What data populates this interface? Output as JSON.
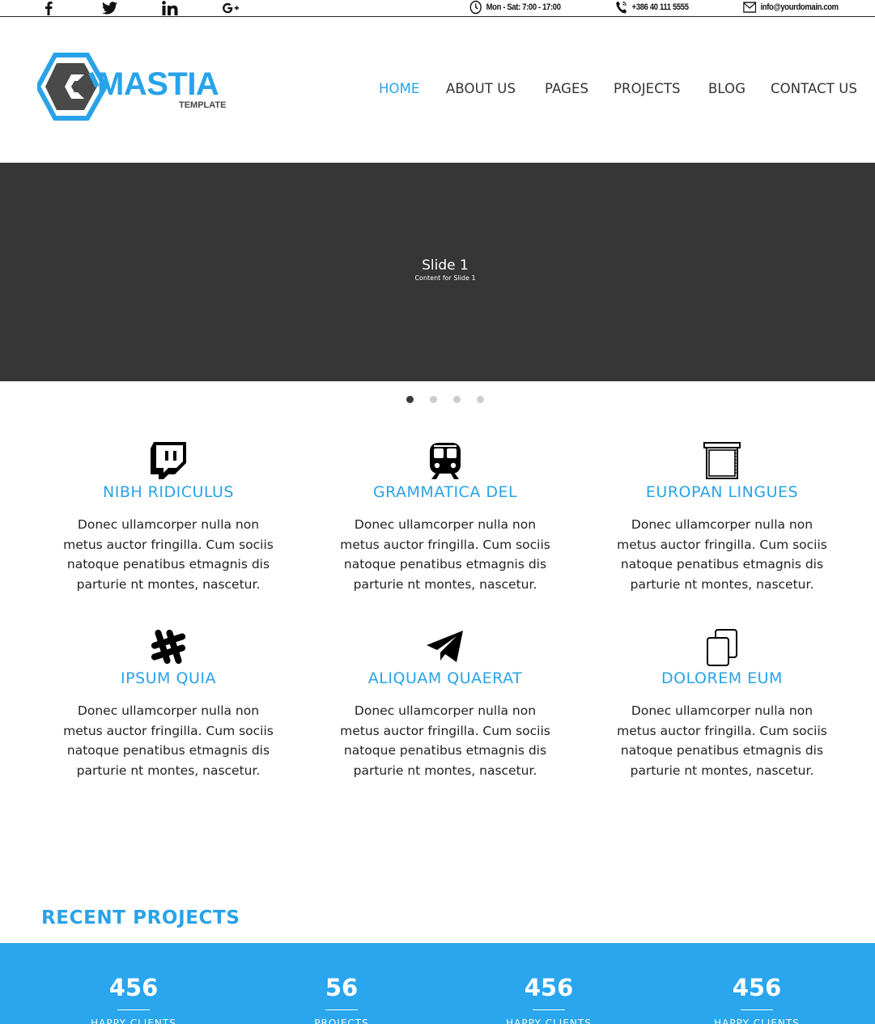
{
  "topbar": {
    "social": [
      {
        "icon": "facebook-icon"
      },
      {
        "icon": "twitter-icon"
      },
      {
        "icon": "linkedin-icon"
      },
      {
        "icon": "google-plus-icon"
      }
    ],
    "hours": "Mon - Sat: 7:00 - 17:00",
    "phone": "+386 40 111 5555",
    "email": "info@yourdomain.com"
  },
  "header": {
    "logo_name": "MASTIA",
    "logo_sub": "TEMPLATE",
    "nav": [
      {
        "label": "HOME",
        "active": true
      },
      {
        "label": "ABOUT US"
      },
      {
        "label": "PAGES"
      },
      {
        "label": "PROJECTS"
      },
      {
        "label": "BLOG"
      },
      {
        "label": "CONTACT US"
      }
    ]
  },
  "slider": {
    "title": "Slide 1",
    "subtitle": "Content for Slide 1",
    "dots": 4,
    "active_dot": 1
  },
  "features": [
    {
      "icon": "twitch-icon",
      "title": "NIBH RIDICULUS",
      "text": "Donec ullamcorper nulla non metus auctor fringilla. Cum sociis natoque penatibus etmagnis dis parturie nt montes, nascetur."
    },
    {
      "icon": "train-icon",
      "title": "GRAMMATICA DEL",
      "text": "Donec ullamcorper nulla non metus auctor fringilla. Cum sociis natoque penatibus etmagnis dis parturie nt montes, nascetur."
    },
    {
      "icon": "window-blind-icon",
      "title": "EUROPAN LINGUES",
      "text": "Donec ullamcorper nulla non metus auctor fringilla. Cum sociis natoque penatibus etmagnis dis parturie nt montes, nascetur."
    },
    {
      "icon": "slack-hashtag-icon",
      "title": "IPSUM QUIA",
      "text": "Donec ullamcorper nulla non metus auctor fringilla. Cum sociis natoque penatibus etmagnis dis parturie nt montes, nascetur."
    },
    {
      "icon": "paper-plane-icon",
      "title": "ALIQUAM QUAERAT",
      "text": "Donec ullamcorper nulla non metus auctor fringilla. Cum sociis natoque penatibus etmagnis dis parturie nt montes, nascetur."
    },
    {
      "icon": "copy-documents-icon",
      "title": "DOLOREM EUM",
      "text": "Donec ullamcorper nulla non metus auctor fringilla. Cum sociis natoque penatibus etmagnis dis parturie nt montes, nascetur."
    }
  ],
  "recent_projects": {
    "title": "RECENT PROJECTS"
  },
  "counters": [
    {
      "value": "456",
      "label": "HAPPY CLIENTS"
    },
    {
      "value": "56",
      "label": "PROJECTS"
    },
    {
      "value": "456",
      "label": "HAPPY CLIENTS"
    },
    {
      "value": "456",
      "label": "HAPPY CLIENTS"
    }
  ],
  "colors": {
    "accent": "#29a3e8",
    "counter_band": "#29a6ee",
    "slider_bg": "#363636"
  }
}
